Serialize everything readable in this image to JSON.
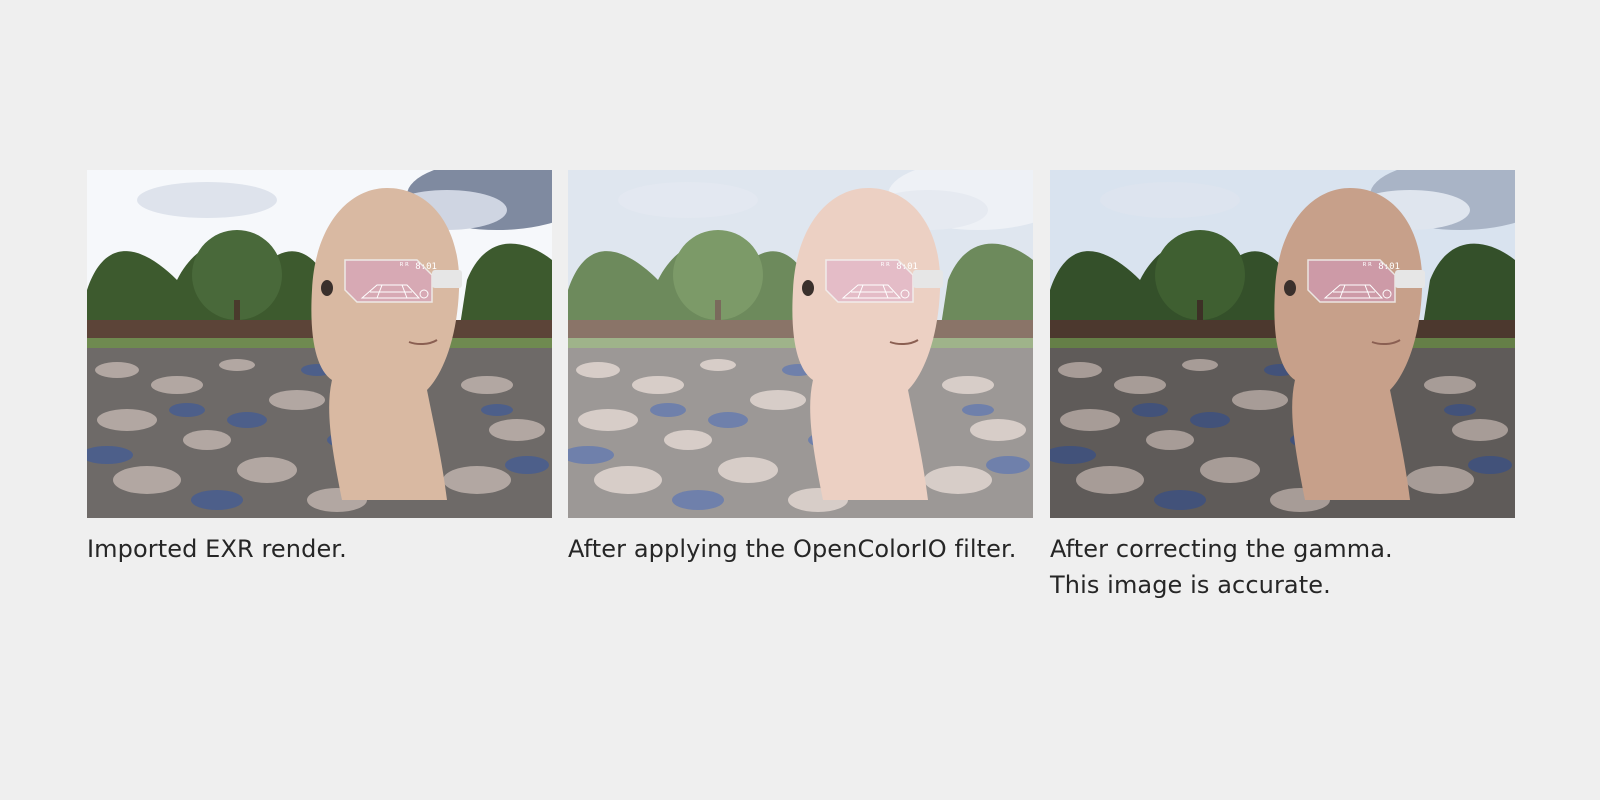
{
  "panels": [
    {
      "caption": [
        "Imported EXR render."
      ],
      "tone": "raw"
    },
    {
      "caption": [
        "After applying the OpenColorIO filter."
      ],
      "tone": "washed"
    },
    {
      "caption": [
        "After correcting the gamma.",
        "This image is accurate."
      ],
      "tone": "corrected"
    }
  ],
  "hud_text": "ᴿᴿ 8:01",
  "colors": {
    "background": "#efefef",
    "text": "#262626",
    "skin_raw": "#d9b9a2",
    "skin_washed": "#ecd0c3",
    "skin_corrected": "#c7a08a",
    "visor": "#d7a7b8"
  }
}
